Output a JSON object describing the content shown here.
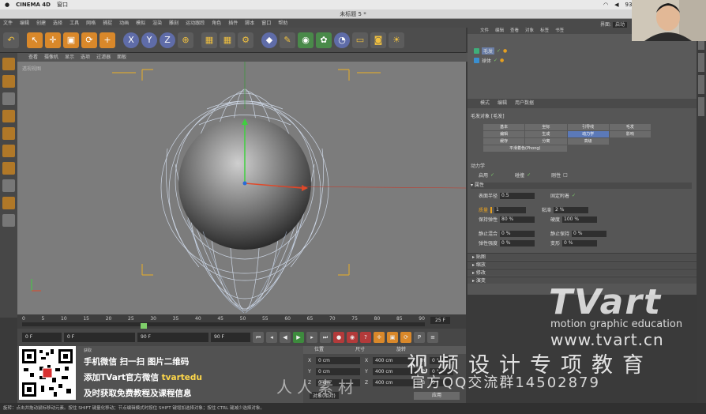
{
  "mac_menu": {
    "apple": "",
    "app": "CINEMA 4D",
    "window": "窗口",
    "battery": "93%",
    "user": "周"
  },
  "window_title": "未标题 5 *",
  "menubar": [
    "文件",
    "编辑",
    "创建",
    "选择",
    "工具",
    "网格",
    "捕捉",
    "动画",
    "模拟",
    "渲染",
    "雕刻",
    "运动跟踪",
    "角色",
    "插件",
    "脚本",
    "窗口",
    "帮助"
  ],
  "layout_label": "界面:",
  "layout_value": "启动",
  "viewport_menu": [
    "查看",
    "摄像机",
    "显示",
    "选项",
    "过滤器",
    "面板"
  ],
  "viewport_label": "透视视图",
  "timeline": {
    "ticks": [
      "0",
      "5",
      "10",
      "15",
      "20",
      "25",
      "30",
      "35",
      "40",
      "45",
      "50",
      "55",
      "60",
      "65",
      "70",
      "75",
      "80",
      "85",
      "90"
    ],
    "current": "25",
    "end_label": "25 F"
  },
  "transport": {
    "start": "0 F",
    "field2": "0 F",
    "end": "90 F",
    "field4": "90 F"
  },
  "material_menu": "材质",
  "coords": {
    "headers": [
      "位置",
      "尺寸",
      "旋转"
    ],
    "rows": [
      {
        "axis1": "X",
        "pos": "0 cm",
        "axis2": "X",
        "size": "400 cm",
        "axis3": "H",
        "rot": "0 °"
      },
      {
        "axis1": "Y",
        "pos": "0 cm",
        "axis2": "Y",
        "size": "400 cm",
        "axis3": "P",
        "rot": "0 °"
      },
      {
        "axis1": "Z",
        "pos": "0 cm",
        "axis2": "Z",
        "size": "400 cm",
        "axis3": "B",
        "rot": "0 °"
      }
    ],
    "mode": "对象(相对)",
    "apply": "应用"
  },
  "status": "旋转：点击并拖动鼠标移动元素。按住 SHIFT 键量化移动；节点编辑模式时按住 SHIFT 键增加选择对象；按住 CTRL 键减少选择对象。",
  "right_top_menu": [
    "文件",
    "编辑",
    "查看",
    "对象",
    "标签",
    "书签"
  ],
  "objects": [
    {
      "name": "毛发",
      "icon_color": "#3a8fd0"
    },
    {
      "name": "球体",
      "icon_color": "#3a8fd0"
    }
  ],
  "attr_menu": [
    "模式",
    "编辑",
    "用户数据"
  ],
  "attr_title": "毛发对象 [毛发]",
  "tabs": [
    "基本",
    "坐标",
    "引导线",
    "毛发",
    "编辑",
    "生成",
    "动力学",
    "影响",
    "缓存",
    "分离",
    "高级",
    "平滑着色(Phong)"
  ],
  "active_tab": "动力学",
  "dynamics_header": "动力学",
  "enable_label": "启用",
  "collision_label": "碰撞",
  "stiff_label": "刚性",
  "props_header": "属性",
  "properties": [
    {
      "label": "表面半径",
      "value": "0.5"
    },
    {
      "label": "固定附着",
      "value": ""
    },
    {
      "label": "质量",
      "value": "1"
    },
    {
      "label": "粘滞",
      "value": "2 %"
    },
    {
      "label": "保持弹性",
      "value": "80 %"
    },
    {
      "label": "硬度",
      "value": "100 %"
    },
    {
      "label": "静止混合",
      "value": "0 %"
    },
    {
      "label": "静止保持",
      "value": "0 %"
    },
    {
      "label": "弹性强度",
      "value": "0 %"
    },
    {
      "label": "变形",
      "value": "0 %"
    }
  ],
  "collapsed_sections": [
    "贴图",
    "缩放",
    "修改",
    "演变"
  ],
  "watermark": {
    "logo": "TVart",
    "tagline": "motion graphic education",
    "url": "www.tvart.cn",
    "cn_line": "视频设计专项教育",
    "qq_line": "官方QQ交流群14502879",
    "site_mark": "人人素材"
  },
  "promo": {
    "line0": "获取",
    "line1": "手机微信  扫一扫  图片二维码",
    "line2_a": "添加TVart官方微信 ",
    "line2_b": "tvartedu",
    "line3": "及时获取免费教程及课程信息"
  }
}
